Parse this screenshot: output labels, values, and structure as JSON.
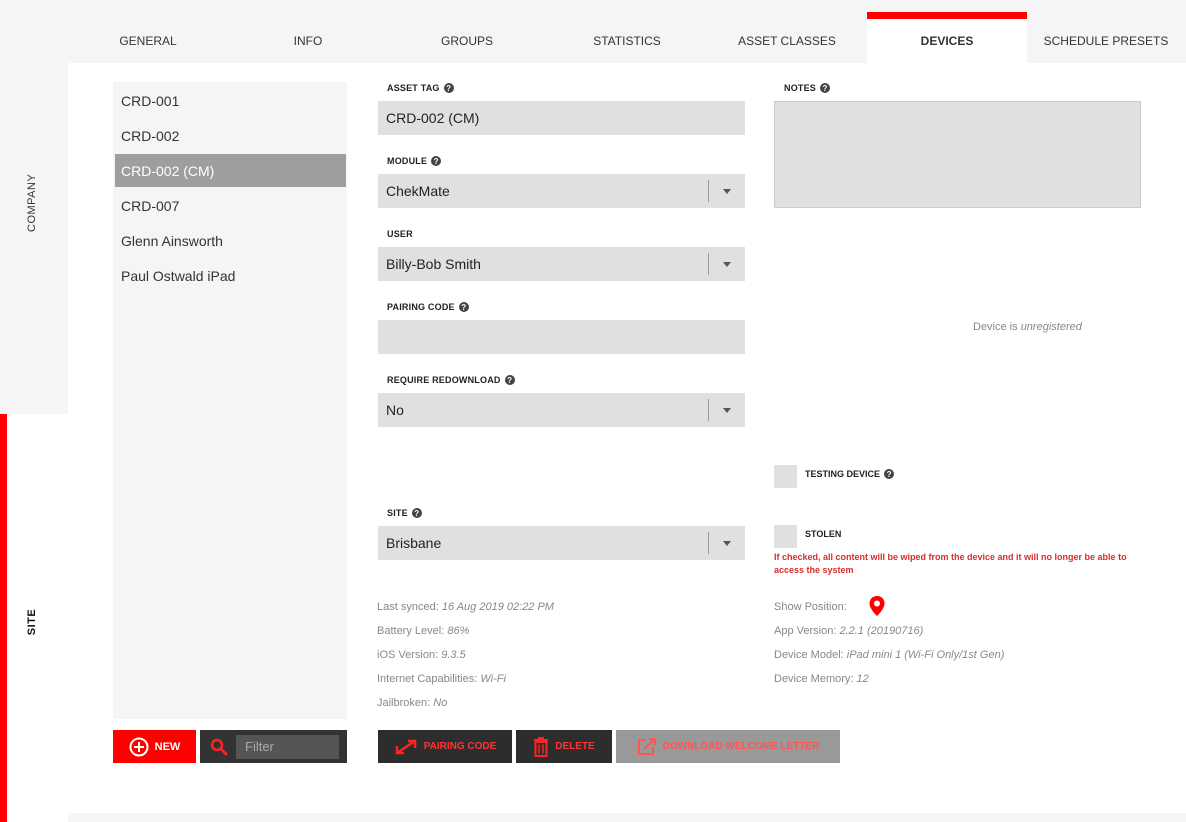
{
  "rail": {
    "company_label": "COMPANY",
    "site_label": "SITE"
  },
  "tabs": [
    "GENERAL",
    "INFO",
    "GROUPS",
    "STATISTICS",
    "ASSET CLASSES",
    "DEVICES",
    "SCHEDULE PRESETS"
  ],
  "active_tab": "DEVICES",
  "devices": [
    "CRD-001",
    "CRD-002",
    "CRD-002 (CM)",
    "CRD-007",
    "Glenn Ainsworth",
    "Paul Ostwald iPad"
  ],
  "selected_device": "CRD-002 (CM)",
  "buttons": {
    "new_label": "NEW",
    "filter_placeholder": "Filter"
  },
  "form": {
    "asset_tag_label": "ASSET TAG",
    "asset_tag_value": "CRD-002 (CM)",
    "module_label": "MODULE",
    "module_value": "ChekMate",
    "user_label": "USER",
    "user_value": "Billy-Bob Smith",
    "pairing_code_label": "PAIRING CODE",
    "pairing_code_value": "",
    "require_redownload_label": "REQUIRE REDOWNLOAD",
    "require_redownload_value": "No",
    "site_label": "SITE",
    "site_value": "Brisbane",
    "notes_label": "NOTES"
  },
  "status": {
    "prefix": "Device is",
    "state": "unregistered"
  },
  "checks": {
    "testing_label": "TESTING DEVICE",
    "stolen_label": "STOLEN",
    "stolen_warning": "If checked, all content will be wiped from the device and it will no longer be able to access the system"
  },
  "info_left": [
    {
      "label": "Last synced:",
      "value": "16 Aug 2019 02:22 PM"
    },
    {
      "label": "Battery Level:",
      "value": "86%"
    },
    {
      "label": "iOS Version:",
      "value": "9.3.5"
    },
    {
      "label": "Internet Capabilities:",
      "value": "Wi-Fi"
    },
    {
      "label": "Jailbroken:",
      "value": "No"
    }
  ],
  "info_right": {
    "show_position_label": "Show Position:",
    "app_version_label": "App Version:",
    "app_version_value": "2.2.1 (20190716)",
    "device_model_label": "Device Model:",
    "device_model_value": "iPad mini 1 (Wi-Fi Only/1st Gen)",
    "device_memory_label": "Device Memory:",
    "device_memory_value": "12"
  },
  "actions": {
    "pairing_code_label": "PAIRING CODE",
    "delete_label": "DELETE",
    "download_label": "DOWNLOAD WELCOME LETTER"
  },
  "colors": {
    "accent": "#ff0000",
    "warning": "#d32f2f",
    "dark_button": "#2d2d2d"
  }
}
